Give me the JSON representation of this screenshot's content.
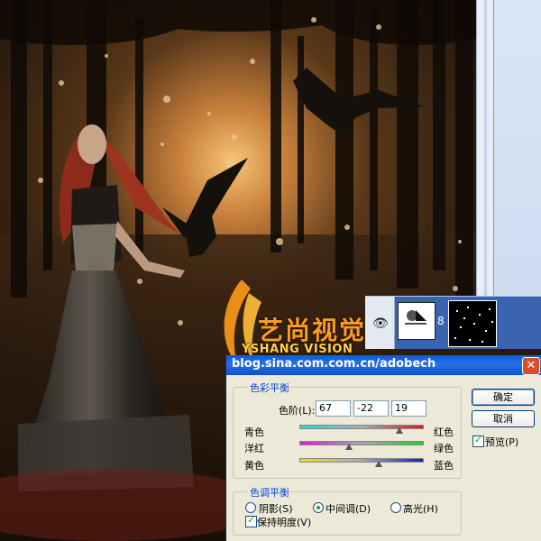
{
  "watermark": {
    "cn": "艺尚视觉",
    "en": "YSHANG VISION"
  },
  "layers_panel": {
    "eye_glyph": "👁",
    "chain_glyph": "8"
  },
  "dialog": {
    "title": "blog.sina.com.com.cn/adobech",
    "close_label": "✕",
    "color_balance": {
      "legend": "色彩平衡",
      "levels_label": "色阶(L):",
      "values": [
        "67",
        "-22",
        "19"
      ],
      "sliders": [
        {
          "left": "青色",
          "right": "红色",
          "value": 67
        },
        {
          "left": "洋红",
          "right": "绿色",
          "value": -22
        },
        {
          "left": "黄色",
          "right": "蓝色",
          "value": 19
        }
      ]
    },
    "tone_balance": {
      "legend": "色调平衡",
      "options": [
        {
          "label": "阴影(S)",
          "selected": false
        },
        {
          "label": "中间调(D)",
          "selected": true
        },
        {
          "label": "高光(H)",
          "selected": false
        }
      ],
      "preserve_luminosity": {
        "label": "保持明度(V)",
        "checked": true
      }
    },
    "buttons": {
      "ok": "确定",
      "cancel": "取消"
    },
    "preview": {
      "label": "预览(P)",
      "checked": true
    }
  },
  "colors": {
    "titlebar": "#0a5bdf",
    "dialog_bg": "#ece9d8",
    "group_title": "#0046d5",
    "watermark_cn": "#ff9a1a",
    "watermark_en": "#ffd24a"
  }
}
